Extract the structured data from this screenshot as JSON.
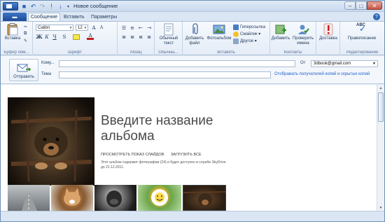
{
  "window": {
    "title": "Новое сообщение",
    "accent": "#2b67b9",
    "close_color": "#c45241",
    "link_color": "#1f62c8"
  },
  "qat": {
    "icons": [
      "save-icon",
      "undo-icon",
      "redo-icon",
      "flag-icon",
      "down-arrow-icon",
      "customize-icon"
    ]
  },
  "tabs": {
    "file_glyph": "▬",
    "items": [
      {
        "label": "Сообщение",
        "active": true
      },
      {
        "label": "Вставить",
        "active": false
      },
      {
        "label": "Параметры",
        "active": false
      }
    ]
  },
  "ribbon": {
    "clipboard": {
      "paste_label": "Вставка",
      "group_label": "Буфер обм..."
    },
    "font": {
      "family": "Calibri",
      "size": "12",
      "bold": "Ж",
      "italic": "К",
      "underline": "Ч",
      "group_label": "Шрифт",
      "highlight_color": "#f4e84a",
      "text_color": "#c81b1b"
    },
    "paragraph": {
      "group_label": "Абзац"
    },
    "styles": {
      "plain_text_label": "Обычный текст",
      "group_label": "Обычны..."
    },
    "insert": {
      "attach_label": "Добавить файл",
      "photo_album_label": "Фотоальбом",
      "hyperlink_label": "Гиперссылка",
      "emoji_label": "Смайлик",
      "other_label": "Другое",
      "group_label": "Вставить"
    },
    "contacts": {
      "add_label": "Добавить",
      "check_names_label": "Проверить имена",
      "group_label": "Контакты"
    },
    "delivery": {
      "label": "Доставка"
    },
    "editing": {
      "spelling_label": "Правописание",
      "abc": "ABC",
      "group_label": "Редактирование"
    }
  },
  "header": {
    "send_label": "Отправить",
    "to_label": "Кому...",
    "subject_label": "Тема",
    "from_label": "От",
    "from_value": "3dbook@gmail.com",
    "show_cc_bcc": "Отображать получателей копий и скрытых копий"
  },
  "album": {
    "title": "Введите название альбома",
    "slideshow_link": "ПРОСМОТРЕТЬ ПОКАЗ СЛАЙДОВ",
    "download_link": "ЗАГРУЗИТЬ ВСЕ",
    "description": "Этот альбом содержит фотографии (24) и будет доступен в службе SkyDrive до 21.12.2011.",
    "thumbnails": [
      "road-photo",
      "kitten-photo",
      "gorilla-photo",
      "flower-smiley-photo",
      "dog-photo"
    ]
  }
}
